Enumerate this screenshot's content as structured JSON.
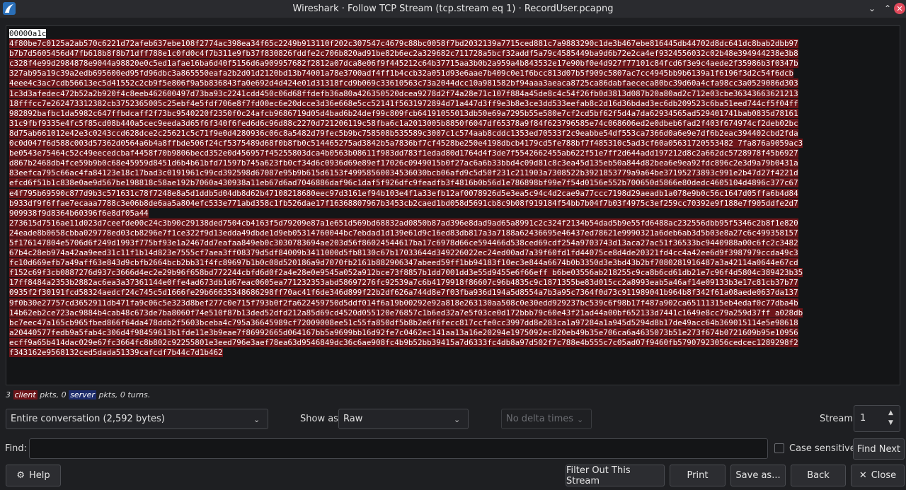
{
  "window": {
    "title": "Wireshark · Follow TCP Stream (tcp.stream eq 1) · RecordUser.pcapng"
  },
  "stream": {
    "lines": [
      "00000a1c",
      "4f80be7c0125a2ab570c6221d72afeb637ebe108f2774ac398ea34f65c2249b913110f202c307547c4679c88bc0058f7bd2032139a7715ced881c7a9883290c1de3b467ebe816445db44702d8dc641dc8bab2dbb97",
      "b7b7d5605456d47fb618b8f8b71dff788e1c0fd0c4f7b311e9fb37f830826fddfe2c706b820ad91be82b6ec2a329682c711728a5bcf32addf5a79c4585449ba9d6b72e2ca4ef9324556032c02b48e394944238e3b8",
      "c328f4e99d2984878e9044a98820e0c5ed1afae16ba6d40f5156d6a909957682f2812a07dca8e06f9f445212c64b37715aa3b0b2a959a4b843532e17e90bf0e4d927f77101c84fcd6f3e9c4aede2f35986b3f0347b",
      "327ab95a19c39a2edb695600ed95fd96dbc3a865550eafa2b2d01d2120bd13b74001a78e3700adf4ff1b4ccb32a051d93e6aae7b409c0e1f6bcc813d07b5f909c5807ac7cc4945bb9b6139a1f6196f3d2c54f6dcb",
      "4eee4c3ac7cdb56613ec5d41552c2cb9f5e806f9a5b836843fa0e692d4d424e01d31318fcd9b069c33610563c73a2044dcc10a981582bf94aaa3aeaca8725ca86dabfaececa80bc39d60a4cfa98cc3a0529086d303",
      "1c3d3afedec472b52a2b920f4c8eeb462600497d73ba93c2241cdd450c06d68ffdefb36a80a426350520dcea9278d2f74a28e71c107f884a45de8c4c54f26fb0d3813d087b20a80ad2c712e03cbe36343663621213",
      "18fffcc7e262473312382cb3752365005c25ebf4e5fdf706e8f7fd00ec6e20dcce3d36e668e5cc52141f5631972894d71a447d3ff9e3b8e3ce3dd533eefab8c2d16d36bdad3ec6db209523c6ba51eed744cf5f04ff",
      "982892bafbc1da5982c647ffbdcaff2f73bc9540220f2350f0c24afcb9686719d05d4bad6b24def99c809fcb64191055013db50e69a7295b55e580e7cf2cd5bf62f5d4a7da62934565ad529401741bab0835d78161",
      "31c9fbf9335e4fc5f85cd08b440a5cec9eeda3d65f6f340f6fed6d6c96d88c2270d721206119c58fba6c1a2013005b8850f6047df65378a9f84f623796585e74c068606ed2e0dbeb6fad2f403f674974cf2deb02bc",
      "8d75ab661012e42e3c0243ccd628dce2c25621c5c71f9e0d4280936c06c8a5482d79fec5b9bc758508b535589c3007c1c574aab8cddc1353ed70533f2c9eabbe54df553ca7366d0a6e9e7df6b2eac394402cbd2fda",
      "0c0d047f6d588c003d57362d0564a6b4a8ffbde506f24cf5375489d68f0b8fb0c514465275ad3842b5a7836bf7cf4528be250e4198dbcb4179cd5fe788bf7f485310c5ad3cf60a05631720553482 7fa876a9059ac3",
      "be0543e75464c52c49eecedcbaf4458f70b9806becd352e0d456957f45255803dca4b0563b08611f983dd783f1edad80d1764d4f3de7f5542662455ab622f51e7ff2d644add197212d8c2a662dc5728978f45b6927",
      "d867b2468db4fce59b9b0c68e45959d8451d6b4b61bfd71597b745a623fb0cf34d6c0936d69e89ef17026c0949015b0f27ac6a6b33bbd4c09d81c8c3ea45d135eb50a844d82bea6e9ea92fdc896c2e3d9a79b0431a",
      "83eefca795c66ac4fa84123e18c17bad3c0191961c99cd392598d67087e95b9b615d6153f49958560034536030bcb06afd9c5d50f231c211903a7308522b3921853779a9a64be37195273893c991e2b47d27f4221d",
      "efcd6f51b1c838e0ae9d567be198818c58ae192b7060a430938a11eb67d6ad7046886daf96c1daf5f926dfc9feadfb3f4816b0b56d1e786898bf99e7f54d0156e552b700650d5866e80dedc4605104d4896c377c67",
      "e4f795b69590c877d9b3c571631c78f7248e8a5d1ddb5d04db8d62b47108218680eec97d3161ef94b103e4f1a33efb12af0078926d5e3ea5c94c4d2cae9a77ccc7198d29aeadb1a078e9b0c56c1647d05ffa6b4d84",
      "b933df9f6ffae7ecaaa7788c3e06b8de6aa5a804efc533e771abd358c1fb526dae17f16368807967b3453cb2caed1bd058d5691cb8c9b08f919184f54bb7b04f7b03f4975c3ef259cc70392e9f188e7f905ddfe2d7",
      "909938f9d8364b60396f6e8df05a44",
      "273615d7516ae11d023d7ceefde00c24c3b90c29138ded7504cb4163f5d79209e87a1e651d569bd68832ad0850b87ad396e8dad9ad65a8991c2c324f2134b54dad5b9e55fd6488ac232556dbb95f5346c2b8f1e820",
      "24eade8b0658cbba029778ed03cb8296e7f1ce322f9d13edda49dbde1d9eb05314760044bc7ebdad1d139e61d9c16ed83db817a3a7188a62436695e46437ed78621e9990321a6deb6ab3d5b03e8a27c6c499358157",
      "5f176147804e5706d6f249d1993f775bf93e1a2467dd7eafaa849eb0c3030783694ae203d56f86024544617ba17c6978d66ce594466d538ced69cdf254a9703743d13aca27ac51f36533bc9440988a00c6fc2c3482",
      "67b4c28eb974a42aa9eed31c11f1b14d823e7555cf7aea3ff08379d5df84009b3411000d5fb8130c67b17033644d349226022ec24ed00ad7a39f60fd1fd44075ce8d4de20321fd4cc4a42ee6d9f3987979ccda49c3",
      "fc10d669efb7a49aff63e843d9cbfb2664bcb2bb31f4fc89697b1b0c08d520186a9d7070fb2161b882906347abeed59ff1bb94183f10ec3e844a6674b0b3350d3e3bd43b2bf7080281916487a3a42114a0644e67cd",
      "f152c69f3cb0887276d937c3666d4ec2e29b96f658bd772244cbfd6d0f2a4e28e0e9545a052a912bce73f8857b1dd7001dd3e55d9455e6f66eff b6be03556ab218255c9ca8b6cd61db21e7c96f4d5804c389423b35",
      "17ff8484a2353b2882ac6ea3a37361144e0ffe4ad673db1d67eac0605ea771232353abd58697276fc92539a7c6b4179918f86607c96b4835c9c1871355be83d015cc2a8993eab5a46af14e09133b3e17c81cb37b77",
      "0935f2f30191fcd58324aedcf24c745c5d1666fe29b66635348686298ff70ac41f6de346d899f22b2df626a744d8e7f03fba936d194a5d8554a7b3a95c7364f0d73c911989041b964b8f342f61a08aede0637da137",
      "9f0b30e27757cd3652911db471fa9c06c5e323d8bef277c0e715f793b0f2fa622459750d5ddf014f6a19b00292e92a818e263130aa508c0e30edd929237bc539c6f98b17f487a902ca65111315eb4edaf0c77dba4b",
      "14b62eb2ce723ac9884b4cab48c673de7ba8060f74e510f87b13ded52dfd212a85d69cd4520d055120e76857c1b6ed32a7e5f03ce0d172bbb79c60e43f21ad44a00bf652133d7441c1649e8cc79a259d37ff a028db",
      "bc7eec47a165cb965fbed866f64da478ddb2f5603bceba4c795a36645989cf72009008ee51c55fa850df5b8b2e6f6fecc817ccfe0cc3997dd8e283ca1a97284a1a945d5294d8b17de49acc64b369015114e5e98618",
      "a20440577fedb9a5fab4c306d4f98459613b1fde11e3b9eae7f86992665d064167bb5a9699bb16d92fe7c0462ec141aa13a16e20294e1975092ec820eb49b35e706ca6a4635073b51e273f674b0721609b95e10956",
      "ecff9a65b414dac029e67fc3664fc8b802c92255801e3eed796e3aef78ea63d9546849dc36c6ae908fc4b9b52bb39415a7d6333fc4db8a97d502f7c788e4b555c7c05ad07f9460fb57907923056cedcec1289298f2",
      "f343162e9568132ced5dada51339cafcdf7b44c7d1b462"
    ]
  },
  "stats": {
    "prefix": "3",
    "client": "client",
    "middle": "pkts, 0",
    "server": "server",
    "suffix": "pkts, 0 turns."
  },
  "controls": {
    "conversation": "Entire conversation (2,592 bytes)",
    "show_as_label": "Show as",
    "show_as_value": "Raw",
    "delta": "No delta times",
    "stream_label": "Stream",
    "stream_value": "1",
    "find_label": "Find:",
    "find_value": "",
    "case_sensitive": "Case sensitive",
    "find_next": "Find Next"
  },
  "buttons": {
    "help": "Help",
    "filter_out": "Filter Out This Stream",
    "print": "Print",
    "save_as": "Save as...",
    "back": "Back",
    "close": "Close"
  },
  "icons": {
    "app": "wireshark-fin-icon",
    "help": "lifebuoy-icon",
    "close": "x-icon"
  },
  "colors": {
    "client_bg": "#6e1519",
    "server_bg": "#1c2b6b",
    "stream_bg": "#141517",
    "window_bg": "#1e1f22"
  }
}
